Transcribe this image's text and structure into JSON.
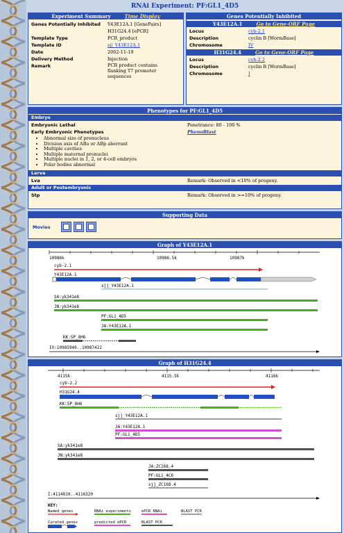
{
  "page_title": "RNAi Experiment: PF:GL1_4D5",
  "experiment": {
    "header": "Experiment Summary",
    "time_display": "Time Display",
    "rows": [
      {
        "label": "Genes Potentially Inhibited",
        "value": "Y43E12A.1 [GenePairs]"
      },
      {
        "label": "",
        "value": "H31G24.4 [ePCR]"
      },
      {
        "label": "Template Type",
        "value": "PCR_product"
      },
      {
        "label": "Template ID",
        "value": "sjj_Y43E12A.1"
      },
      {
        "label": "Date",
        "value": "2002-11-19"
      },
      {
        "label": "Delivery Method",
        "value": "Injection"
      },
      {
        "label": "Remark",
        "value": "PCR product contains flanking T7 promoter sequences"
      }
    ]
  },
  "genes": {
    "header": "Genes Potentially Inhibited",
    "blocks": [
      {
        "name": "Y43E12A.1",
        "link": "Go to Gene-ORF Page",
        "locus": "cyb-2.1",
        "description": "cyclin B [WormBase]",
        "chromosome": "IV"
      },
      {
        "name": "H31G24.4",
        "link": "Go to Gene-ORF Page",
        "locus": "cyb-2.2",
        "description": "cyclin B [WormBase]",
        "chromosome": "I"
      }
    ],
    "locus_label": "Locus",
    "desc_label": "Description",
    "chrom_label": "Chromosome"
  },
  "phenotypes": {
    "header": "Phenotypes for PF:GL1_4D5",
    "embryo": "Embryo",
    "embryonic_lethal": "Embryonic Lethal",
    "penetrance": "Penetrance: 80 - 100 %",
    "early": "Early Embryonic Phenotypes",
    "phenoblast": "PhenoBlast",
    "list": [
      "Abnormal size of pronucleus",
      "Division axis of ABa or ABp aberrant",
      "Multiple cavities",
      "Multiple maternal pronuclei",
      "Multiple nuclei in 1, 2, or 4-cell embryos",
      "Polar bodies abnormal"
    ],
    "larva": "Larva",
    "lva": "Lva",
    "lva_remark": "Remark: Observed in <10% of progeny.",
    "adult": "Adult or Postembryonic",
    "stp": "Stp",
    "stp_remark": "Remark: Observed in >=10% of progeny."
  },
  "supporting": {
    "header": "Supporting Data",
    "movies": "Movies"
  },
  "graph1": {
    "header": "Graph of Y43E12A.1",
    "ticks": [
      "10986k",
      "10986.5k",
      "10987k"
    ],
    "labels": {
      "cyb": "cyb-2.1",
      "gene": "Y43E12A.1",
      "sjj": "sjj_Y43E12A.1",
      "sa": "SA:yk341e8",
      "jn": "JN:yk341e8",
      "pf": "PF:GL1_4D5",
      "ja": "JA:Y43E12A.1",
      "kk": "KK:SP_8H6",
      "coord": "IV:10985940..10987422"
    }
  },
  "graph2": {
    "header": "Graph of H31G24.4",
    "ticks": [
      "4115k",
      "4115.5k",
      "4116k"
    ],
    "labels": {
      "cyb": "cyb-2.2",
      "gene": "H31G24.4",
      "kk": "KK:SP_8H6",
      "sjj": "sjj_Y43E12A.1",
      "ja": "JA:Y43E12A.1",
      "pf": "PF:GL1_4D5",
      "sa": "SA:yk341e8",
      "jn": "JN:yk341e8",
      "jazc": "JA:ZC168.4",
      "pf2": "PF:GL1_4C6",
      "sjjzc": "sjj_ZC168.4",
      "coord": "I:4114819..4116320"
    }
  },
  "key": {
    "title": "KEY:",
    "items": [
      "Named genes",
      "RNAi experiments",
      "ePCR RNAi",
      "BLAST PCR",
      "Curated genes",
      "predicted ePCR",
      "BLAST PCR"
    ]
  }
}
